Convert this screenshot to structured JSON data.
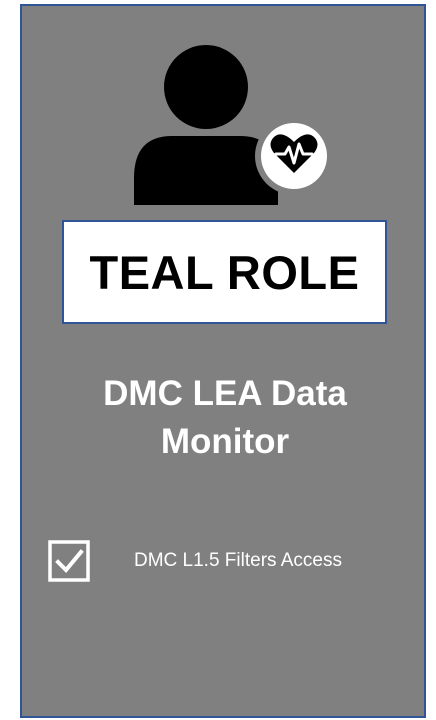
{
  "role": {
    "badge_label": "TEAL ROLE",
    "title_line1": "DMC LEA Data",
    "title_line2": "Monitor"
  },
  "permissions": [
    {
      "label": "DMC L1.5 Filters Access",
      "checked": true
    }
  ],
  "icons": {
    "role_icon": "user-health-icon",
    "permission_check": "checkbox-checked-icon"
  },
  "colors": {
    "card_background": "#808080",
    "border": "#2f5597",
    "text_light": "#ffffff",
    "text_dark": "#000000"
  }
}
